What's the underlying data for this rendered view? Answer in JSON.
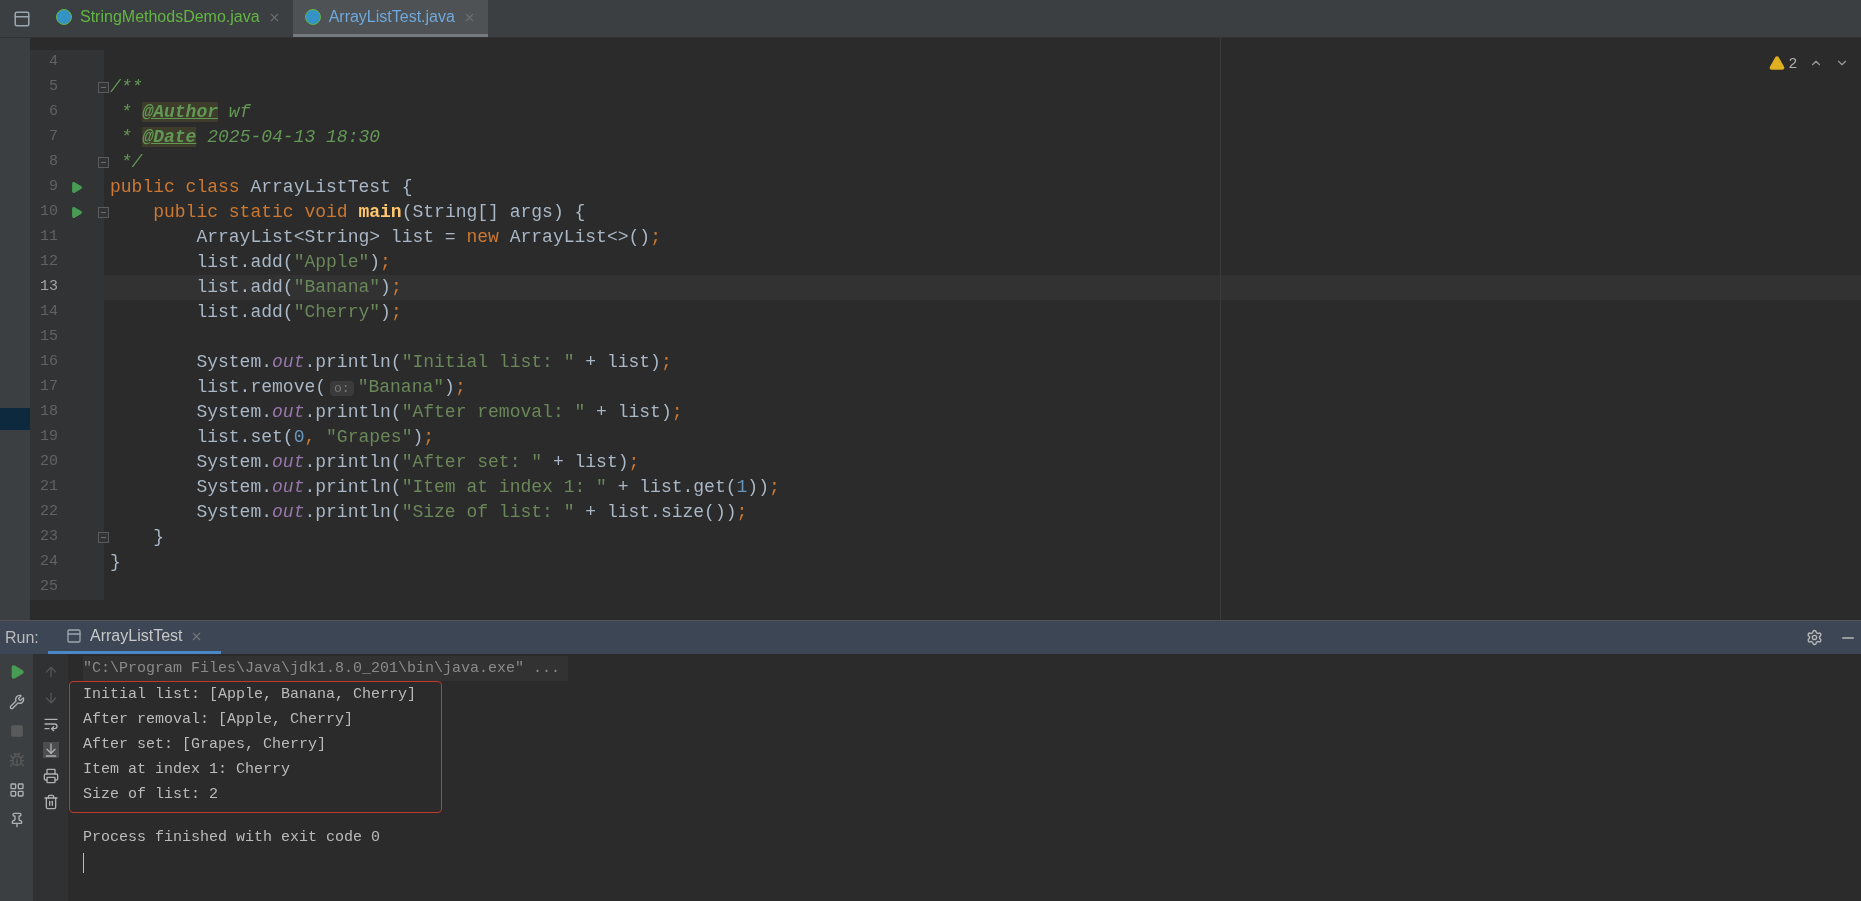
{
  "tabs": [
    {
      "label": "StringMethodsDemo.java",
      "selected": false
    },
    {
      "label": "ArrayListTest.java",
      "selected": true
    }
  ],
  "inspections": {
    "count": "2"
  },
  "editor": {
    "lines": [
      {
        "number": "4",
        "current": false,
        "run": false,
        "fold_marker": false
      },
      {
        "number": "5",
        "current": false,
        "run": false,
        "fold_marker": true,
        "tokens": [
          {
            "kind": "comment",
            "text": "/**"
          }
        ]
      },
      {
        "number": "6",
        "current": false,
        "run": false,
        "fold_marker": false,
        "tokens": [
          {
            "kind": "comment",
            "text": " * "
          },
          {
            "kind": "doctag",
            "text": "@Author"
          },
          {
            "kind": "comment",
            "text": " wf"
          }
        ]
      },
      {
        "number": "7",
        "current": false,
        "run": false,
        "fold_marker": false,
        "tokens": [
          {
            "kind": "comment",
            "text": " * "
          },
          {
            "kind": "doctag",
            "text": "@Date"
          },
          {
            "kind": "comment",
            "text": " 2025-04-13 18:30"
          }
        ]
      },
      {
        "number": "8",
        "current": false,
        "run": false,
        "fold_marker": true,
        "tokens": [
          {
            "kind": "comment",
            "text": " */"
          }
        ]
      },
      {
        "number": "9",
        "current": false,
        "run": true,
        "fold_marker": false,
        "tokens": [
          {
            "kind": "kw",
            "text": "public class "
          },
          {
            "kind": "plain",
            "text": "ArrayListTest {"
          }
        ]
      },
      {
        "number": "10",
        "current": false,
        "run": true,
        "fold_marker": true,
        "tokens": [
          {
            "kind": "kw",
            "text": "    public static void "
          },
          {
            "kind": "method",
            "text": "main"
          },
          {
            "kind": "plain",
            "text": "(String[] args) {"
          }
        ]
      },
      {
        "number": "11",
        "current": false,
        "run": false,
        "fold_marker": false,
        "tokens": [
          {
            "kind": "plain",
            "text": "        ArrayList<String> list = "
          },
          {
            "kind": "kw",
            "text": "new "
          },
          {
            "kind": "plain",
            "text": "ArrayList<>()"
          },
          {
            "kind": "kw",
            "text": ";"
          }
        ]
      },
      {
        "number": "12",
        "current": false,
        "run": false,
        "fold_marker": false,
        "tokens": [
          {
            "kind": "plain",
            "text": "        list.add("
          },
          {
            "kind": "str",
            "text": "\"Apple\""
          },
          {
            "kind": "plain",
            "text": ")"
          },
          {
            "kind": "kw",
            "text": ";"
          }
        ]
      },
      {
        "number": "13",
        "current": true,
        "run": false,
        "fold_marker": false,
        "tokens": [
          {
            "kind": "plain",
            "text": "        list.add("
          },
          {
            "kind": "str",
            "text": "\"Banana\""
          },
          {
            "kind": "plain",
            "text": ")"
          },
          {
            "kind": "kw",
            "text": ";"
          }
        ]
      },
      {
        "number": "14",
        "current": false,
        "run": false,
        "fold_marker": false,
        "tokens": [
          {
            "kind": "plain",
            "text": "        list.add("
          },
          {
            "kind": "str",
            "text": "\"Cherry\""
          },
          {
            "kind": "plain",
            "text": ")"
          },
          {
            "kind": "kw",
            "text": ";"
          }
        ]
      },
      {
        "number": "15",
        "current": false,
        "run": false,
        "fold_marker": false
      },
      {
        "number": "16",
        "current": false,
        "run": false,
        "fold_marker": false,
        "tokens": [
          {
            "kind": "plain",
            "text": "        System."
          },
          {
            "kind": "field",
            "text": "out"
          },
          {
            "kind": "plain",
            "text": ".println("
          },
          {
            "kind": "str",
            "text": "\"Initial list: \""
          },
          {
            "kind": "plain",
            "text": " + list)"
          },
          {
            "kind": "kw",
            "text": ";"
          }
        ]
      },
      {
        "number": "17",
        "current": false,
        "run": false,
        "fold_marker": false,
        "tokens": [
          {
            "kind": "plain",
            "text": "        list.remove("
          },
          {
            "kind": "hint",
            "text": "o:"
          },
          {
            "kind": "str",
            "text": "\"Banana\""
          },
          {
            "kind": "plain",
            "text": ")"
          },
          {
            "kind": "kw",
            "text": ";"
          }
        ]
      },
      {
        "number": "18",
        "current": false,
        "run": false,
        "fold_marker": false,
        "tokens": [
          {
            "kind": "plain",
            "text": "        System."
          },
          {
            "kind": "field",
            "text": "out"
          },
          {
            "kind": "plain",
            "text": ".println("
          },
          {
            "kind": "str",
            "text": "\"After removal: \""
          },
          {
            "kind": "plain",
            "text": " + list)"
          },
          {
            "kind": "kw",
            "text": ";"
          }
        ]
      },
      {
        "number": "19",
        "current": false,
        "run": false,
        "fold_marker": false,
        "tokens": [
          {
            "kind": "plain",
            "text": "        list.set("
          },
          {
            "kind": "num",
            "text": "0"
          },
          {
            "kind": "kw",
            "text": ", "
          },
          {
            "kind": "str",
            "text": "\"Grapes\""
          },
          {
            "kind": "plain",
            "text": ")"
          },
          {
            "kind": "kw",
            "text": ";"
          }
        ]
      },
      {
        "number": "20",
        "current": false,
        "run": false,
        "fold_marker": false,
        "tokens": [
          {
            "kind": "plain",
            "text": "        System."
          },
          {
            "kind": "field",
            "text": "out"
          },
          {
            "kind": "plain",
            "text": ".println("
          },
          {
            "kind": "str",
            "text": "\"After set: \""
          },
          {
            "kind": "plain",
            "text": " + list)"
          },
          {
            "kind": "kw",
            "text": ";"
          }
        ]
      },
      {
        "number": "21",
        "current": false,
        "run": false,
        "fold_marker": false,
        "tokens": [
          {
            "kind": "plain",
            "text": "        System."
          },
          {
            "kind": "field",
            "text": "out"
          },
          {
            "kind": "plain",
            "text": ".println("
          },
          {
            "kind": "str",
            "text": "\"Item at index 1: \""
          },
          {
            "kind": "plain",
            "text": " + list.get("
          },
          {
            "kind": "num",
            "text": "1"
          },
          {
            "kind": "plain",
            "text": "))"
          },
          {
            "kind": "kw",
            "text": ";"
          }
        ]
      },
      {
        "number": "22",
        "current": false,
        "run": false,
        "fold_marker": false,
        "tokens": [
          {
            "kind": "plain",
            "text": "        System."
          },
          {
            "kind": "field",
            "text": "out"
          },
          {
            "kind": "plain",
            "text": ".println("
          },
          {
            "kind": "str",
            "text": "\"Size of list: \""
          },
          {
            "kind": "plain",
            "text": " + list.size())"
          },
          {
            "kind": "kw",
            "text": ";"
          }
        ]
      },
      {
        "number": "23",
        "current": false,
        "run": false,
        "fold_marker": true,
        "tokens": [
          {
            "kind": "plain",
            "text": "    }"
          }
        ]
      },
      {
        "number": "24",
        "current": false,
        "run": false,
        "fold_marker": false,
        "tokens": [
          {
            "kind": "plain",
            "text": "}"
          }
        ]
      },
      {
        "number": "25",
        "current": false,
        "run": false,
        "fold_marker": false
      }
    ]
  },
  "run_panel": {
    "label": "Run:",
    "tab": "ArrayListTest",
    "console": {
      "command": "\"C:\\Program Files\\Java\\jdk1.8.0_201\\bin\\java.exe\" ...",
      "output": [
        "Initial list: [Apple, Banana, Cherry]",
        "After removal: [Apple, Cherry]",
        "After set: [Grapes, Cherry]",
        "Item at index 1: Cherry",
        "Size of list: 2"
      ],
      "exit_message": "Process finished with exit code 0"
    }
  }
}
